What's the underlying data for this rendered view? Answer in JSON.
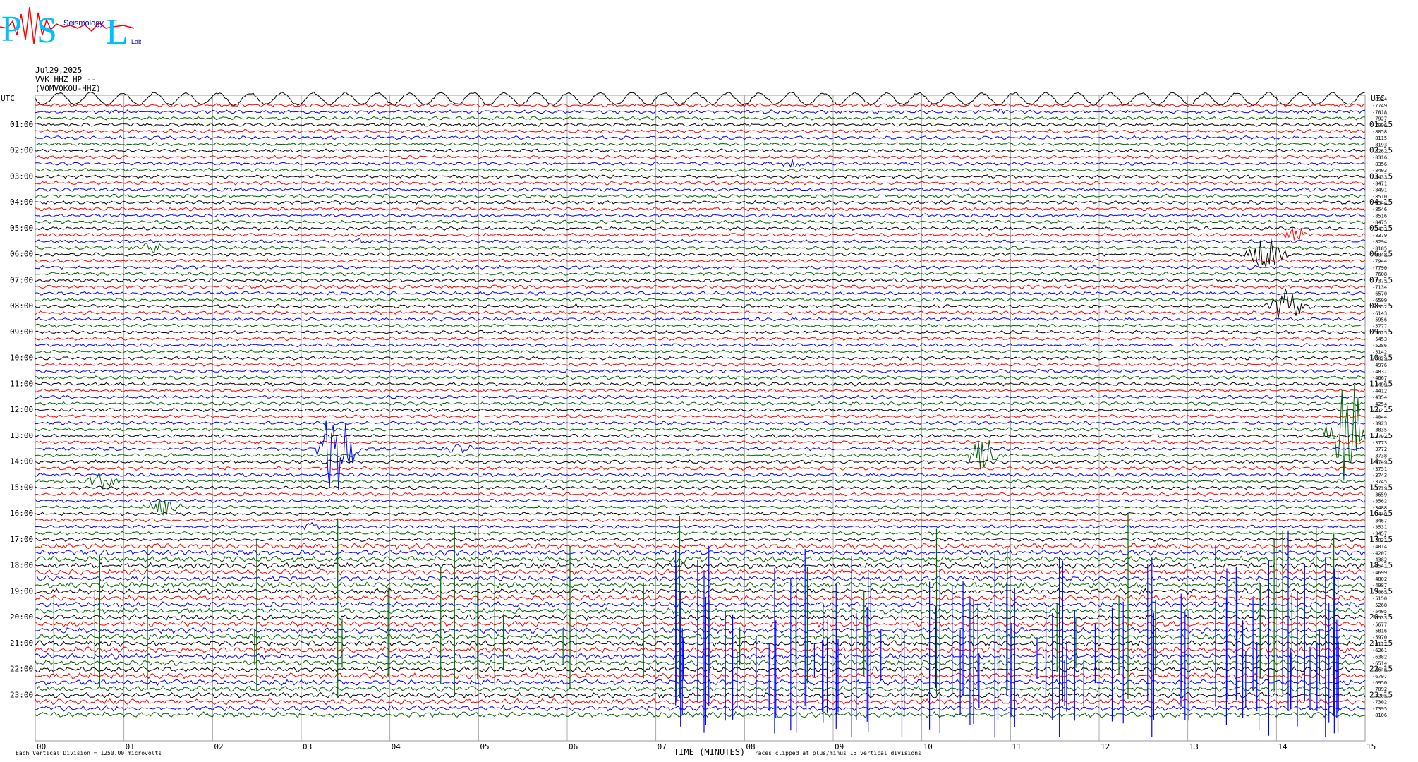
{
  "logo": {
    "letters": [
      "P",
      "S",
      "L"
    ],
    "words": [
      "Seismology",
      "Lab"
    ]
  },
  "header": {
    "date": "Jul29,2025",
    "channel": "VVK HHZ HP --",
    "station": "(VOMVOKOU-HHZ)"
  },
  "chart_data": {
    "type": "line",
    "title": "",
    "left_label": "UTC",
    "right_label": "UTC",
    "left_times": [
      "01:00",
      "02:00",
      "03:00",
      "04:00",
      "05:00",
      "06:00",
      "07:00",
      "08:00",
      "09:00",
      "10:00",
      "11:00",
      "12:00",
      "13:00",
      "14:00",
      "15:00",
      "16:00",
      "17:00",
      "18:00",
      "19:00",
      "20:00",
      "21:00",
      "22:00",
      "23:00"
    ],
    "right_times": [
      "01:15",
      "02:15",
      "03:15",
      "04:15",
      "05:15",
      "06:15",
      "07:15",
      "08:15",
      "09:15",
      "10:15",
      "11:15",
      "12:15",
      "13:15",
      "14:15",
      "15:15",
      "16:15",
      "17:15",
      "18:15",
      "19:15",
      "20:15",
      "21:15",
      "22:15",
      "23:15"
    ],
    "x_ticks": [
      "00",
      "01",
      "02",
      "03",
      "04",
      "05",
      "06",
      "07",
      "08",
      "09",
      "10",
      "11",
      "12",
      "13",
      "14",
      "15"
    ],
    "xlim": [
      0,
      15
    ],
    "trace_colors": [
      "#000000",
      "#ff0000",
      "#0000ff",
      "#006400"
    ],
    "trace_count": 96,
    "offsets": [
      -8924,
      -7749,
      -7818,
      -7927,
      -7996,
      -8058,
      -8115,
      -8193,
      -8262,
      -8316,
      -8356,
      -8403,
      -8433,
      -8471,
      -8491,
      -8510,
      -8544,
      -8546,
      -8516,
      -8475,
      -8433,
      -8379,
      -8294,
      -8185,
      -8048,
      -7944,
      -7790,
      -7608,
      -7375,
      -7134,
      -6570,
      -6599,
      -6352,
      -6143,
      -5956,
      -5777,
      -5615,
      -5453,
      -5286,
      -5142,
      -5029,
      -4976,
      -4837,
      -4667,
      -4499,
      -4412,
      -4354,
      -4254,
      -4142,
      -4044,
      -3923,
      -3835,
      -3793,
      -3773,
      -3772,
      -3738,
      -3749,
      -3751,
      -3743,
      -3745,
      -3719,
      -3659,
      -3562,
      -3488,
      -3440,
      -3467,
      -3531,
      -3457,
      -3821,
      -4014,
      -4207,
      -4382,
      -4541,
      -4699,
      -4802,
      -4987,
      -5065,
      -5150,
      -5268,
      -5405,
      -5533,
      -5677,
      -5816,
      -5970,
      -6117,
      -6261,
      -6382,
      -6514,
      -6646,
      -6797,
      -6950,
      -7092,
      -7205,
      -7302,
      -7395,
      -8106
    ],
    "events": [
      {
        "trace": 0,
        "x": 7.5,
        "amp": 0.2,
        "color": "#000000"
      },
      {
        "trace": 2,
        "x": 10.9,
        "amp": 0.5,
        "color": "#0000ff"
      },
      {
        "trace": 10,
        "x": 8.6,
        "amp": 0.6,
        "color": "#0000ff"
      },
      {
        "trace": 23,
        "x": 1.3,
        "amp": 0.7,
        "color": "#000000"
      },
      {
        "trace": 22,
        "x": 3.7,
        "amp": 0.3,
        "color": "#006400"
      },
      {
        "trace": 22,
        "x": 6.4,
        "amp": 0.3,
        "color": "#006400"
      },
      {
        "trace": 21,
        "x": 14.2,
        "amp": 1.2,
        "color": "#ff0000"
      },
      {
        "trace": 24,
        "x": 13.9,
        "amp": 3.5,
        "color": "#000000"
      },
      {
        "trace": 28,
        "x": 2.6,
        "amp": 0.3,
        "color": "#006400"
      },
      {
        "trace": 32,
        "x": 6.2,
        "amp": 0.3,
        "color": "#000000"
      },
      {
        "trace": 32,
        "x": 14.1,
        "amp": 3.0,
        "color": "#000000"
      },
      {
        "trace": 51,
        "x": 14.8,
        "amp": 9.0,
        "color": "#ff0000"
      },
      {
        "trace": 54,
        "x": 3.4,
        "amp": 9.0,
        "color": "#0000ff"
      },
      {
        "trace": 54,
        "x": 4.8,
        "amp": 0.8,
        "color": "#0000ff"
      },
      {
        "trace": 55,
        "x": 10.7,
        "amp": 2.5,
        "color": "#006400"
      },
      {
        "trace": 59,
        "x": 0.75,
        "amp": 1.4,
        "color": "#006400"
      },
      {
        "trace": 63,
        "x": 1.45,
        "amp": 1.4,
        "color": "#006400"
      },
      {
        "trace": 66,
        "x": 3.1,
        "amp": 0.5,
        "color": "#0000ff"
      },
      {
        "trace": 71,
        "x": 7.25,
        "amp": 0.9,
        "color": "#006400"
      }
    ]
  },
  "footer": {
    "scale_text": "Each Vertical Division = 1250.00 microvolts",
    "time_label": "TIME (MINUTES)",
    "clip_text": "Traces clipped at plus/minus 15 vertical divisions"
  }
}
